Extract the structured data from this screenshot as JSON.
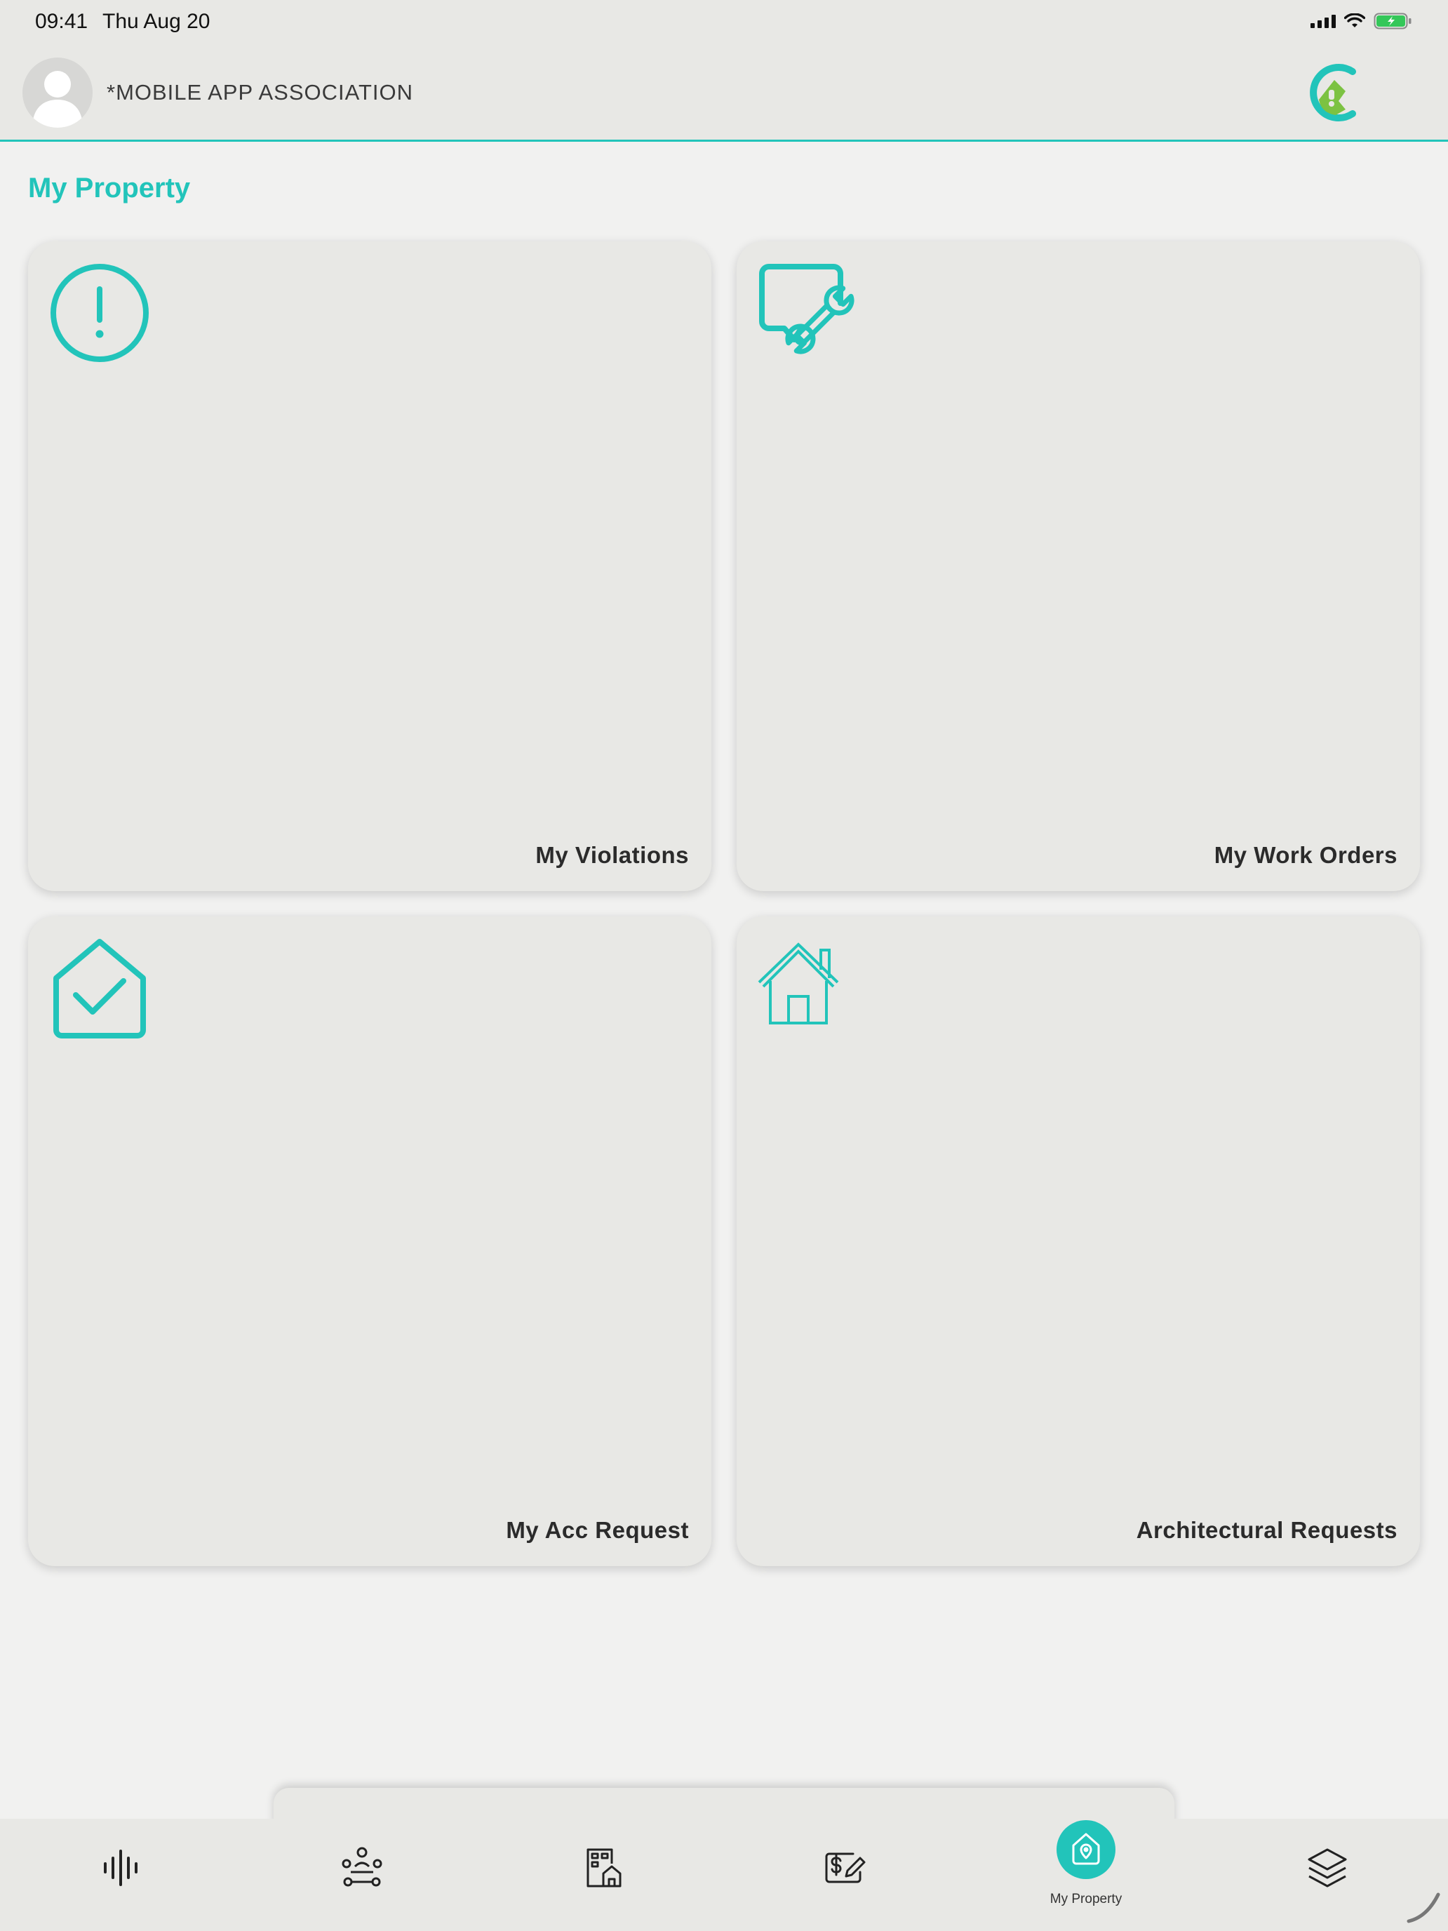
{
  "status_bar": {
    "time": "09:41",
    "date": "Thu Aug 20"
  },
  "header": {
    "association_name": "*MOBILE APP ASSOCIATION",
    "avatar_icon": "user-avatar-icon",
    "logo_icon": "association-logo-icon"
  },
  "colors": {
    "accent": "#22c4ba",
    "card_background": "#e8e8e5",
    "page_background": "#f1f1f0",
    "logo_green": "#7cc242"
  },
  "page_title": "My Property",
  "cards": [
    {
      "label": "My Violations",
      "icon": "alert-circle-icon"
    },
    {
      "label": "My Work Orders",
      "icon": "wrench-message-icon"
    },
    {
      "label": "My Acc Request",
      "icon": "house-check-icon"
    },
    {
      "label": "Architectural Requests",
      "icon": "house-icon"
    }
  ],
  "bottom_nav": {
    "items": [
      {
        "icon": "activity-icon",
        "label": ""
      },
      {
        "icon": "community-icon",
        "label": ""
      },
      {
        "icon": "building-home-icon",
        "label": ""
      },
      {
        "icon": "payment-edit-icon",
        "label": ""
      },
      {
        "icon": "home-location-icon",
        "label": "My Property",
        "active": true
      },
      {
        "icon": "layers-icon",
        "label": ""
      }
    ]
  }
}
